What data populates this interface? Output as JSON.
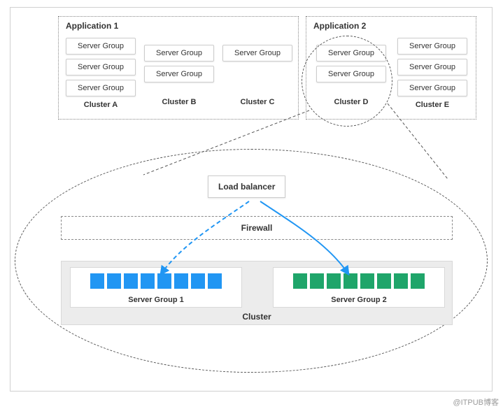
{
  "app1": {
    "title": "Application 1",
    "clusters": [
      {
        "name": "Cluster A",
        "groups": [
          "Server Group",
          "Server Group",
          "Server Group"
        ]
      },
      {
        "name": "Cluster B",
        "groups": [
          "Server Group",
          "Server Group"
        ]
      },
      {
        "name": "Cluster C",
        "groups": [
          "Server Group"
        ]
      }
    ]
  },
  "app2": {
    "title": "Application 2",
    "clusters": [
      {
        "name": "Cluster D",
        "groups": [
          "Server Group",
          "Server Group"
        ]
      },
      {
        "name": "Cluster E",
        "groups": [
          "Server Group",
          "Server Group",
          "Server Group"
        ]
      }
    ]
  },
  "detail": {
    "load_balancer": "Load balancer",
    "firewall": "Firewall",
    "cluster_label": "Cluster",
    "sg1": {
      "label": "Server Group 1",
      "color": "#2196f3",
      "tiles": 8
    },
    "sg2": {
      "label": "Server Group 2",
      "color": "#1fa56a",
      "tiles": 8
    }
  },
  "watermark": "@ITPUB博客",
  "chart_data": {
    "type": "diagram",
    "description": "Spinnaker/cluster management concept: two applications each containing clusters, each cluster containing server groups. Cluster D of Application 2 is expanded into a detailed view showing a load balancer routing through a firewall to two server groups (blue/green) inside one cluster.",
    "applications": [
      {
        "name": "Application 1",
        "clusters": [
          {
            "name": "Cluster A",
            "server_groups": 3
          },
          {
            "name": "Cluster B",
            "server_groups": 2
          },
          {
            "name": "Cluster C",
            "server_groups": 1
          }
        ]
      },
      {
        "name": "Application 2",
        "clusters": [
          {
            "name": "Cluster D",
            "server_groups": 2,
            "highlighted": true
          },
          {
            "name": "Cluster E",
            "server_groups": 3
          }
        ]
      }
    ],
    "expanded_cluster": {
      "source": "Cluster D",
      "components": [
        "Load balancer",
        "Firewall",
        "Server Group 1",
        "Server Group 2"
      ],
      "flows": [
        {
          "from": "Load balancer",
          "to": "Server Group 1",
          "style": "dashed",
          "color": "#2196f3"
        },
        {
          "from": "Load balancer",
          "to": "Server Group 2",
          "style": "solid",
          "color": "#2196f3"
        }
      ]
    }
  }
}
